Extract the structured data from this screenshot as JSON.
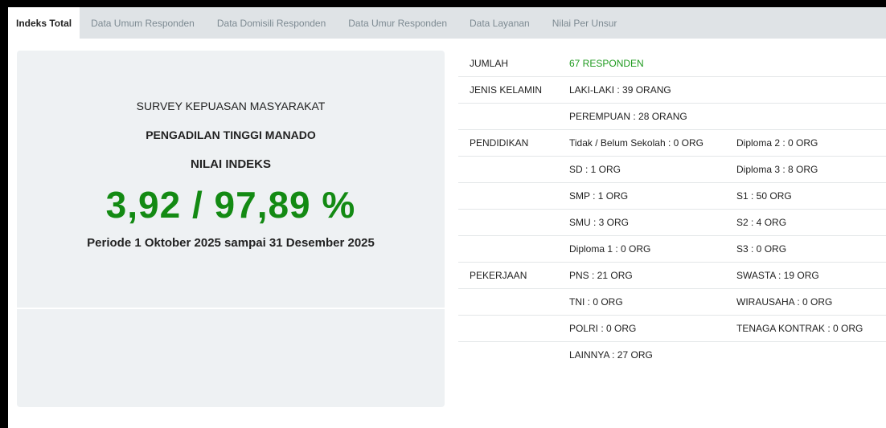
{
  "tabs": [
    {
      "label": "Indeks Total",
      "active": true
    },
    {
      "label": "Data Umum Responden"
    },
    {
      "label": "Data Domisili Responden"
    },
    {
      "label": "Data Umur Responden"
    },
    {
      "label": "Data Layanan"
    },
    {
      "label": "Nilai Per Unsur"
    }
  ],
  "summary": {
    "survey_title": "SURVEY KEPUASAN MASYARAKAT",
    "court_name": "PENGADILAN TINGGI MANADO",
    "index_label": "NILAI INDEKS",
    "score": "3,92 / 97,89 %",
    "period": "Periode 1 Oktober 2025 sampai 31 Desember 2025"
  },
  "stats": {
    "rows": [
      {
        "label": "JUMLAH",
        "col2": "67 RESPONDEN",
        "col3": ""
      },
      {
        "label": "JENIS KELAMIN",
        "col2": "LAKI-LAKI : 39 ORANG",
        "col3": ""
      },
      {
        "label": "",
        "col2": "PEREMPUAN : 28 ORANG",
        "col3": ""
      },
      {
        "label": "PENDIDIKAN",
        "col2": "Tidak / Belum Sekolah : 0 ORG",
        "col3": "Diploma 2 : 0 ORG"
      },
      {
        "label": "",
        "col2": "SD : 1 ORG",
        "col3": "Diploma 3 : 8 ORG"
      },
      {
        "label": "",
        "col2": "SMP : 1 ORG",
        "col3": "S1 : 50 ORG"
      },
      {
        "label": "",
        "col2": "SMU : 3 ORG",
        "col3": "S2 : 4 ORG"
      },
      {
        "label": "",
        "col2": "Diploma 1 : 0 ORG",
        "col3": "S3 : 0 ORG"
      },
      {
        "label": "PEKERJAAN",
        "col2": "PNS : 21 ORG",
        "col3": "SWASTA : 19 ORG"
      },
      {
        "label": "",
        "col2": "TNI : 0 ORG",
        "col3": "WIRAUSAHA : 0 ORG"
      },
      {
        "label": "",
        "col2": "POLRI : 0 ORG",
        "col3": "TENAGA KONTRAK : 0 ORG"
      },
      {
        "label": "",
        "col2": "LAINNYA : 27 ORG",
        "col3": ""
      }
    ]
  },
  "colors": {
    "accent_green": "#138a13",
    "tab_bar": "#dfe3e6",
    "panel": "#eef1f3"
  }
}
